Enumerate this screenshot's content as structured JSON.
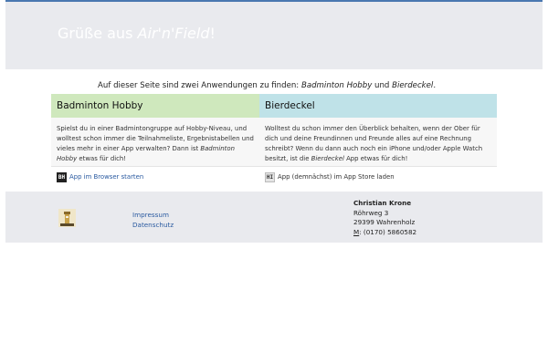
{
  "hero": {
    "prefix": "Grüße aus ",
    "brand": "Air'n'Field",
    "suffix": "!"
  },
  "intro": {
    "text_before": "Auf dieser Seite sind zwei Anwendungen zu finden: ",
    "app1": "Badminton Hobby",
    "and": " und ",
    "app2": "Bierdeckel",
    "end": "."
  },
  "cards": [
    {
      "title": "Badminton Hobby",
      "body_before": "Spielst du in einer Badmintongruppe auf Hobby-Niveau, und wolltest schon immer die Teilnahmeliste, Ergebnistabellen und vieles mehr in einer App verwalten? Dann ist ",
      "body_em": "Badminton Hobby",
      "body_after": " etwas für dich!",
      "icon": "badminton-hobby-app-icon",
      "icon_text": "BH",
      "link": "App im Browser starten",
      "color": "#cfe8bd"
    },
    {
      "title": "Bierdeckel",
      "body_before": "Wolltest du schon immer den Überblick behalten, wenn der Ober für dich und deine Freundinnen und Freunde alles auf eine Rechnung schreibt? Wenn du dann auch noch ein iPhone und/oder Apple Watch besitzt, ist die ",
      "body_em": "Bierdeckel",
      "body_after": " App etwas für dich!",
      "icon": "bierdeckel-app-icon",
      "icon_text": "HI",
      "link": "App (demnächst) im App Store laden",
      "color": "#bfe2e8"
    }
  ],
  "footer": {
    "links": [
      "Impressum",
      "Datenschutz"
    ],
    "address": {
      "name": "Christian Krone",
      "street": "Röhrweg 3",
      "city": "29399 Wahrenholz",
      "phone_label": "M",
      "phone": ": (0170) 5860582"
    }
  },
  "colors": {
    "accent": "#4a78b0",
    "link": "#2a5aa0",
    "hero_bg": "#e9eaee"
  }
}
